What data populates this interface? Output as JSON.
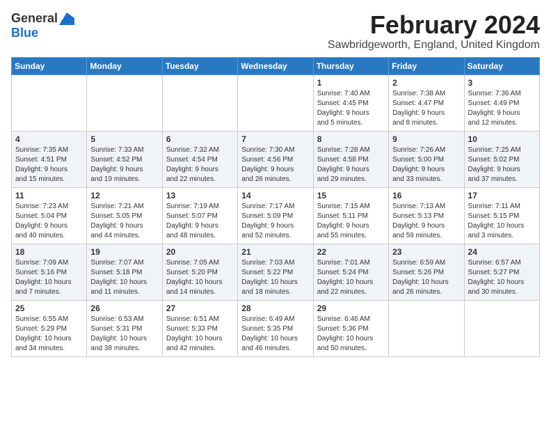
{
  "logo": {
    "general": "General",
    "blue": "Blue"
  },
  "header": {
    "month": "February 2024",
    "location": "Sawbridgeworth, England, United Kingdom"
  },
  "weekdays": [
    "Sunday",
    "Monday",
    "Tuesday",
    "Wednesday",
    "Thursday",
    "Friday",
    "Saturday"
  ],
  "weeks": [
    [
      {
        "day": "",
        "info": ""
      },
      {
        "day": "",
        "info": ""
      },
      {
        "day": "",
        "info": ""
      },
      {
        "day": "",
        "info": ""
      },
      {
        "day": "1",
        "info": "Sunrise: 7:40 AM\nSunset: 4:45 PM\nDaylight: 9 hours\nand 5 minutes."
      },
      {
        "day": "2",
        "info": "Sunrise: 7:38 AM\nSunset: 4:47 PM\nDaylight: 9 hours\nand 8 minutes."
      },
      {
        "day": "3",
        "info": "Sunrise: 7:36 AM\nSunset: 4:49 PM\nDaylight: 9 hours\nand 12 minutes."
      }
    ],
    [
      {
        "day": "4",
        "info": "Sunrise: 7:35 AM\nSunset: 4:51 PM\nDaylight: 9 hours\nand 15 minutes."
      },
      {
        "day": "5",
        "info": "Sunrise: 7:33 AM\nSunset: 4:52 PM\nDaylight: 9 hours\nand 19 minutes."
      },
      {
        "day": "6",
        "info": "Sunrise: 7:32 AM\nSunset: 4:54 PM\nDaylight: 9 hours\nand 22 minutes."
      },
      {
        "day": "7",
        "info": "Sunrise: 7:30 AM\nSunset: 4:56 PM\nDaylight: 9 hours\nand 26 minutes."
      },
      {
        "day": "8",
        "info": "Sunrise: 7:28 AM\nSunset: 4:58 PM\nDaylight: 9 hours\nand 29 minutes."
      },
      {
        "day": "9",
        "info": "Sunrise: 7:26 AM\nSunset: 5:00 PM\nDaylight: 9 hours\nand 33 minutes."
      },
      {
        "day": "10",
        "info": "Sunrise: 7:25 AM\nSunset: 5:02 PM\nDaylight: 9 hours\nand 37 minutes."
      }
    ],
    [
      {
        "day": "11",
        "info": "Sunrise: 7:23 AM\nSunset: 5:04 PM\nDaylight: 9 hours\nand 40 minutes."
      },
      {
        "day": "12",
        "info": "Sunrise: 7:21 AM\nSunset: 5:05 PM\nDaylight: 9 hours\nand 44 minutes."
      },
      {
        "day": "13",
        "info": "Sunrise: 7:19 AM\nSunset: 5:07 PM\nDaylight: 9 hours\nand 48 minutes."
      },
      {
        "day": "14",
        "info": "Sunrise: 7:17 AM\nSunset: 5:09 PM\nDaylight: 9 hours\nand 52 minutes."
      },
      {
        "day": "15",
        "info": "Sunrise: 7:15 AM\nSunset: 5:11 PM\nDaylight: 9 hours\nand 55 minutes."
      },
      {
        "day": "16",
        "info": "Sunrise: 7:13 AM\nSunset: 5:13 PM\nDaylight: 9 hours\nand 59 minutes."
      },
      {
        "day": "17",
        "info": "Sunrise: 7:11 AM\nSunset: 5:15 PM\nDaylight: 10 hours\nand 3 minutes."
      }
    ],
    [
      {
        "day": "18",
        "info": "Sunrise: 7:09 AM\nSunset: 5:16 PM\nDaylight: 10 hours\nand 7 minutes."
      },
      {
        "day": "19",
        "info": "Sunrise: 7:07 AM\nSunset: 5:18 PM\nDaylight: 10 hours\nand 11 minutes."
      },
      {
        "day": "20",
        "info": "Sunrise: 7:05 AM\nSunset: 5:20 PM\nDaylight: 10 hours\nand 14 minutes."
      },
      {
        "day": "21",
        "info": "Sunrise: 7:03 AM\nSunset: 5:22 PM\nDaylight: 10 hours\nand 18 minutes."
      },
      {
        "day": "22",
        "info": "Sunrise: 7:01 AM\nSunset: 5:24 PM\nDaylight: 10 hours\nand 22 minutes."
      },
      {
        "day": "23",
        "info": "Sunrise: 6:59 AM\nSunset: 5:26 PM\nDaylight: 10 hours\nand 26 minutes."
      },
      {
        "day": "24",
        "info": "Sunrise: 6:57 AM\nSunset: 5:27 PM\nDaylight: 10 hours\nand 30 minutes."
      }
    ],
    [
      {
        "day": "25",
        "info": "Sunrise: 6:55 AM\nSunset: 5:29 PM\nDaylight: 10 hours\nand 34 minutes."
      },
      {
        "day": "26",
        "info": "Sunrise: 6:53 AM\nSunset: 5:31 PM\nDaylight: 10 hours\nand 38 minutes."
      },
      {
        "day": "27",
        "info": "Sunrise: 6:51 AM\nSunset: 5:33 PM\nDaylight: 10 hours\nand 42 minutes."
      },
      {
        "day": "28",
        "info": "Sunrise: 6:49 AM\nSunset: 5:35 PM\nDaylight: 10 hours\nand 46 minutes."
      },
      {
        "day": "29",
        "info": "Sunrise: 6:46 AM\nSunset: 5:36 PM\nDaylight: 10 hours\nand 50 minutes."
      },
      {
        "day": "",
        "info": ""
      },
      {
        "day": "",
        "info": ""
      }
    ]
  ]
}
